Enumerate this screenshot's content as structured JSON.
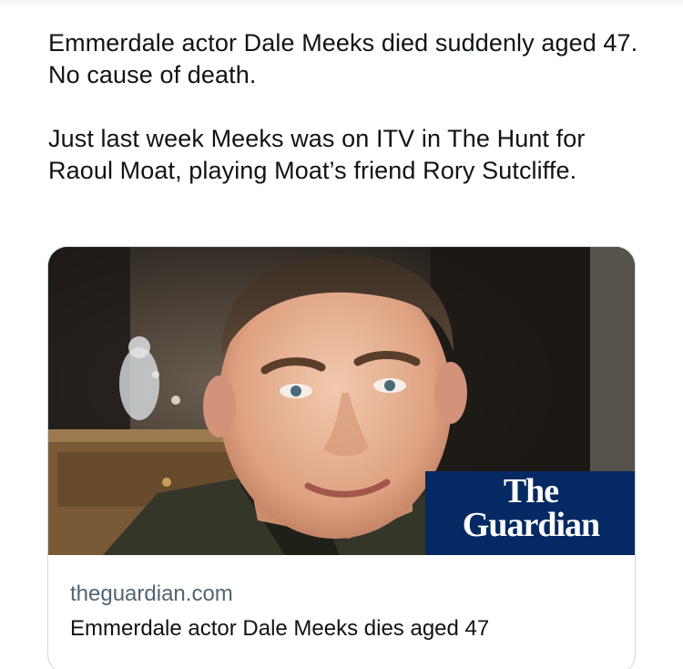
{
  "tweet": {
    "paragraphs": [
      "Emmerdale actor Dale Meeks died suddenly aged 47. No cause of death.",
      "Just last week Meeks was on ITV in The Hunt for Raoul Moat, playing Moat’s friend Rory Sutcliffe."
    ]
  },
  "link_card": {
    "image_icon": "portrait-photo",
    "logo": {
      "line1": "The",
      "line2": "Guardian",
      "background": "#052962",
      "text_color": "#ffffff"
    },
    "domain": "theguardian.com",
    "title": "Emmerdale actor Dale Meeks dies aged 47"
  },
  "colors": {
    "text": "#0f1419",
    "secondary_text": "#536471",
    "border": "#cfd9de"
  }
}
